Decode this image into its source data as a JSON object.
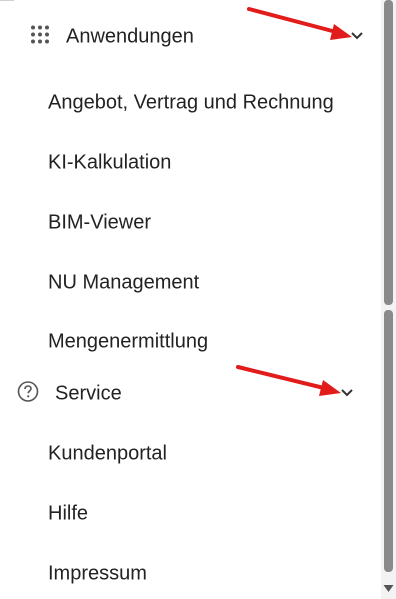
{
  "menu": {
    "sections": [
      {
        "title": "Anwendungen",
        "icon": "grid-dots-icon",
        "expanded": true,
        "items": [
          {
            "label": "Angebot, Vertrag und Rechnung"
          },
          {
            "label": "KI-Kalkulation"
          },
          {
            "label": "BIM-Viewer"
          },
          {
            "label": "NU Management"
          },
          {
            "label": "Mengenermittlung"
          }
        ]
      },
      {
        "title": "Service",
        "icon": "help-circle-icon",
        "expanded": true,
        "items": [
          {
            "label": "Kundenportal"
          },
          {
            "label": "Hilfe"
          },
          {
            "label": "Impressum"
          }
        ]
      }
    ]
  },
  "annotations": {
    "arrow_color": "#e21b1b"
  }
}
